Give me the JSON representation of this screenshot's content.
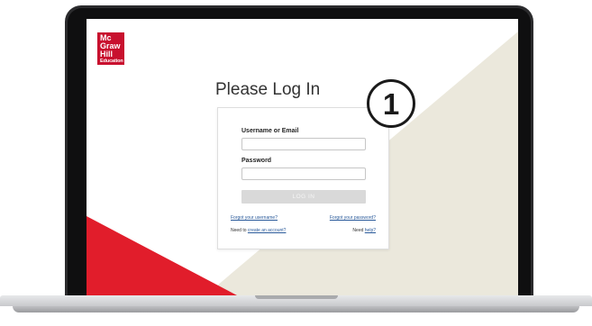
{
  "logo": {
    "line1": "Mc",
    "line2": "Graw",
    "line3": "Hill",
    "line4": "Education"
  },
  "page_title": "Please Log In",
  "form": {
    "username_label": "Username or Email",
    "username_value": "",
    "password_label": "Password",
    "password_value": "",
    "login_button": "LOG IN",
    "forgot_username": "Forgot your username?",
    "forgot_password": "Forgot your password?",
    "need_to": "Need to",
    "create_account": "create an account?",
    "need": "Need",
    "help": "help?"
  },
  "callout": {
    "number": "1"
  },
  "colors": {
    "brand_red": "#c8102e",
    "beige": "#ebe8dc",
    "button_disabled": "#d9d9d9",
    "link": "#2a5a9a"
  }
}
